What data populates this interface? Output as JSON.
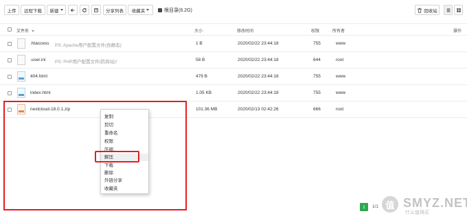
{
  "toolbar": {
    "upload": "上传",
    "remote_download": "远程下载",
    "new": "新建",
    "share_list": "分享列表",
    "favorites": "收藏夹",
    "current_path": "根目录(6.2G)",
    "recycle": "回收站"
  },
  "table": {
    "headers": {
      "name": "文件名",
      "size": "大小",
      "mtime": "修改时间",
      "perm": "权限",
      "owner": "所有者",
      "action": "操作"
    },
    "rows": [
      {
        "name": ".htaccess",
        "ps": "PS: Apache用户配置文件(伪静态)",
        "size": "1 B",
        "mtime": "2020/02/22 23:44:18",
        "perm": "755",
        "owner": "www"
      },
      {
        "name": ".user.ini",
        "ps": "PS: PHP用户配置文件(防跨站)!",
        "size": "58 B",
        "mtime": "2020/02/22 23:44:18",
        "perm": "644",
        "owner": "root"
      },
      {
        "name": "404.html",
        "ps": "",
        "size": "479 B",
        "mtime": "2020/02/22 23:44:18",
        "perm": "755",
        "owner": "www"
      },
      {
        "name": "index.html",
        "ps": "",
        "size": "1.05 KB",
        "mtime": "2020/02/22 23:44:18",
        "perm": "755",
        "owner": "www"
      },
      {
        "name": "nextcloud-18.0.1.zip",
        "ps": "",
        "size": "101.36 MB",
        "mtime": "2020/02/13 02:42:26",
        "perm": "666",
        "owner": "root"
      }
    ]
  },
  "context_menu": {
    "items": [
      "复制",
      "剪切",
      "重命名",
      "权限",
      "压缩",
      "解压",
      "下载",
      "删除",
      "外链分享",
      "收藏夹"
    ],
    "highlighted": "解压"
  },
  "pager": {
    "current": "1",
    "total": "1/1"
  },
  "watermark": {
    "text": "SMYZ.NET",
    "sub": "什么值得买",
    "logo": "值"
  },
  "colors": {
    "highlight_red": "#e31c1c",
    "pager_green": "#2fa84f"
  }
}
